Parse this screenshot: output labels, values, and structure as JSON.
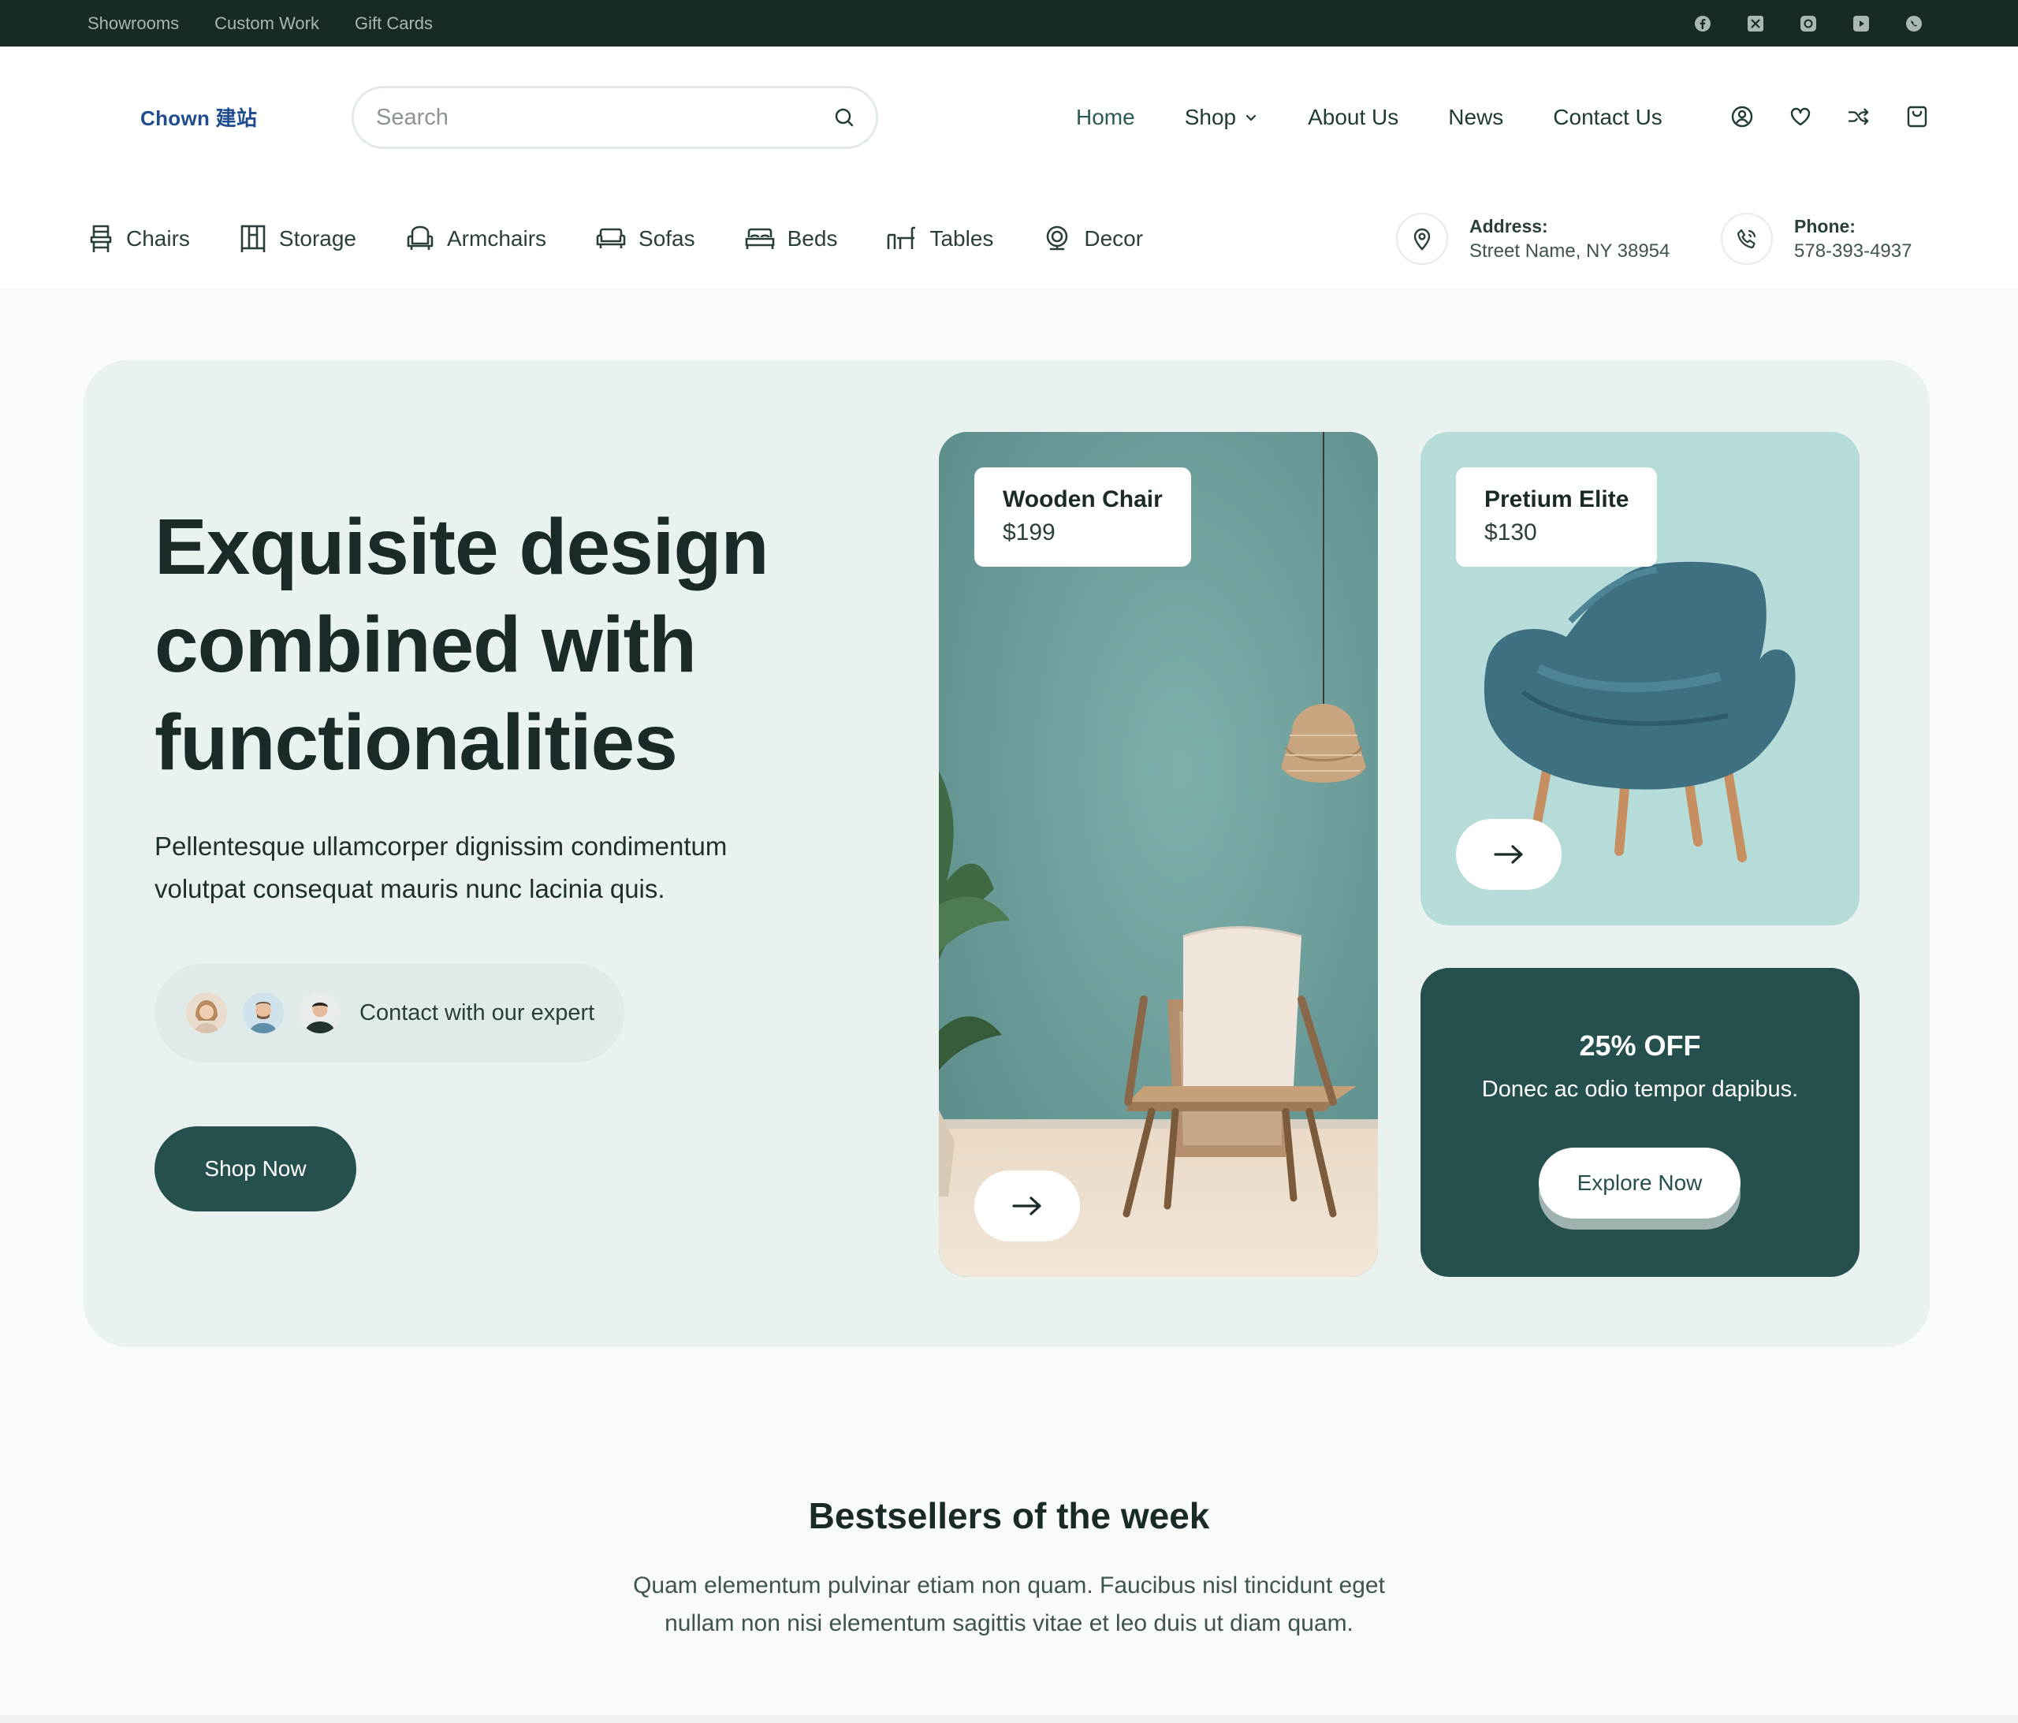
{
  "topbar": {
    "links": [
      "Showrooms",
      "Custom Work",
      "Gift Cards"
    ],
    "social_icons": [
      "facebook-icon",
      "x-twitter-icon",
      "instagram-icon",
      "youtube-icon",
      "whatsapp-icon"
    ]
  },
  "header": {
    "logo": "Chown 建站",
    "search_placeholder": "Search",
    "nav": [
      "Home",
      "Shop",
      "About Us",
      "News",
      "Contact Us"
    ],
    "action_icons": [
      "account-icon",
      "wishlist-heart-icon",
      "compare-shuffle-icon",
      "cart-bag-icon"
    ]
  },
  "categories": [
    {
      "label": "Chairs",
      "icon": "chair-icon"
    },
    {
      "label": "Storage",
      "icon": "storage-icon"
    },
    {
      "label": "Armchairs",
      "icon": "armchair-icon"
    },
    {
      "label": "Sofas",
      "icon": "sofa-icon"
    },
    {
      "label": "Beds",
      "icon": "bed-icon"
    },
    {
      "label": "Tables",
      "icon": "table-icon"
    },
    {
      "label": "Decor",
      "icon": "decor-icon"
    }
  ],
  "contact": {
    "address_label": "Address:",
    "address_value": "Street Name, NY 38954",
    "phone_label": "Phone:",
    "phone_value": "578-393-4937"
  },
  "hero": {
    "heading_line1": "Exquisite design",
    "heading_line2": "combined with",
    "heading_line3": "functionalities",
    "lead_line1": "Pellentesque ullamcorper dignissim condimentum",
    "lead_line2": "volutpat consequat mauris nunc lacinia quis.",
    "expert_text": "Contact with our expert",
    "shop_button": "Shop Now"
  },
  "products": [
    {
      "name": "Wooden Chair",
      "price": "$199"
    },
    {
      "name": "Pretium Elite",
      "price": "$130"
    }
  ],
  "promo": {
    "title": "25% OFF",
    "text": "Donec ac odio tempor dapibus.",
    "button": "Explore Now"
  },
  "bestsellers": {
    "title": "Bestsellers of the week",
    "text_line1": "Quam elementum pulvinar etiam non quam. Faucibus nisl tincidunt eget",
    "text_line2": "nullam non nisi elementum sagittis vitae et leo duis ut diam quam."
  },
  "colors": {
    "topbar_bg": "#172a27",
    "accent": "#25504d",
    "hero_bg": "#eaf2f0",
    "logo": "#1f4b8f"
  }
}
